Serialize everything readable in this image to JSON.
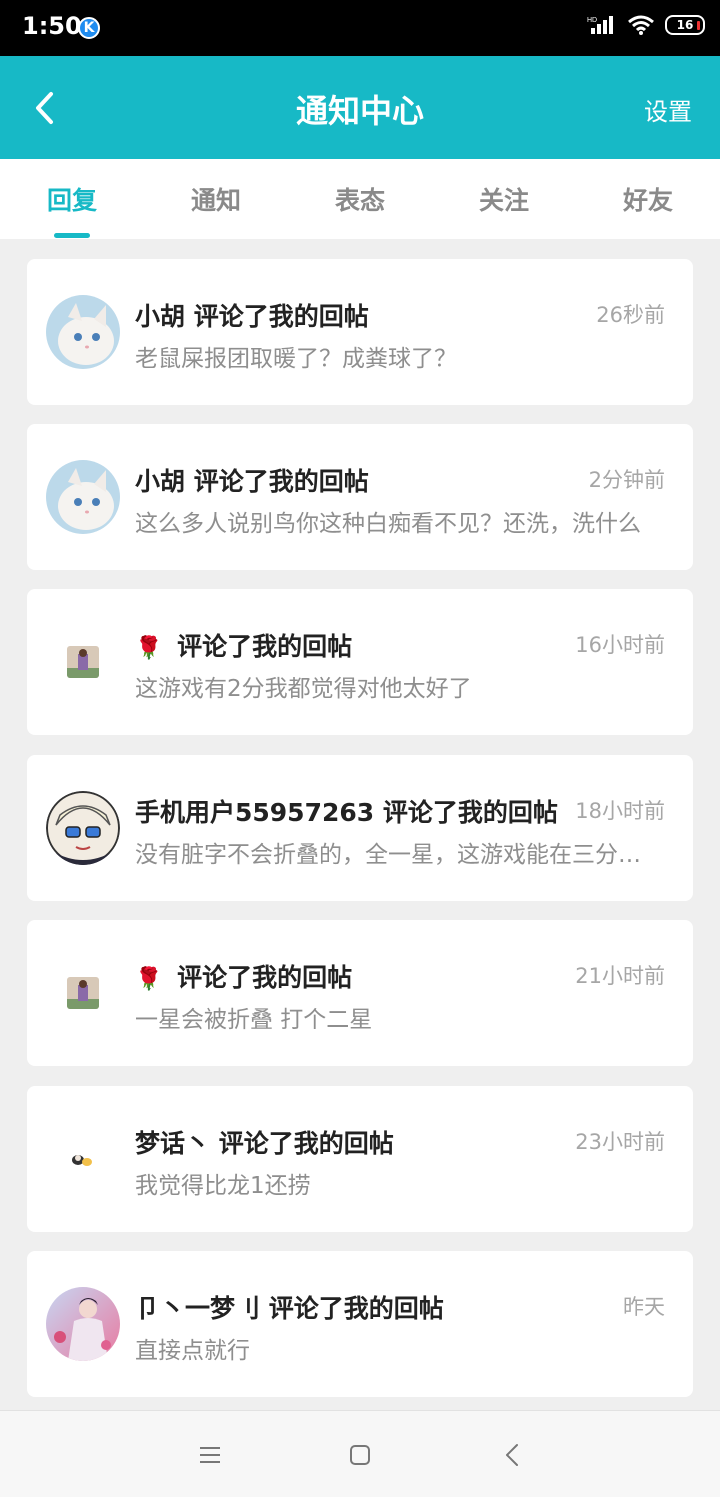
{
  "status_bar": {
    "time": "1:50",
    "app_icon": "K",
    "battery": "16"
  },
  "header": {
    "title": "通知中心",
    "settings": "设置"
  },
  "tabs": [
    {
      "label": "回复",
      "active": true
    },
    {
      "label": "通知",
      "active": false
    },
    {
      "label": "表态",
      "active": false
    },
    {
      "label": "关注",
      "active": false
    },
    {
      "label": "好友",
      "active": false
    }
  ],
  "notifications": [
    {
      "user": "小胡",
      "action": "评论了我的回帖",
      "time": "26秒前",
      "preview": "老鼠屎报团取暖了？成粪球了？"
    },
    {
      "user": "小胡",
      "action": "评论了我的回帖",
      "time": "2分钟前",
      "preview": "这么多人说别鸟你这种白痴看不见？还洗，洗什么"
    },
    {
      "user": "🌹",
      "action": "评论了我的回帖",
      "time": "16小时前",
      "preview": "这游戏有2分我都觉得对他太好了"
    },
    {
      "user": "手机用户55957263",
      "action": "评论了我的回帖",
      "time": "18小时前",
      "preview": "没有脏字不会折叠的，全一星，这游戏能在三分以上"
    },
    {
      "user": "🌹",
      "action": "评论了我的回帖",
      "time": "21小时前",
      "preview": "一星会被折叠  打个二星"
    },
    {
      "user": "梦话丶",
      "action": "评论了我的回帖",
      "time": "23小时前",
      "preview": "我觉得比龙1还捞"
    },
    {
      "user": "卩丶一梦刂",
      "action": "评论了我的回帖",
      "time": "昨天",
      "preview": "直接点就行"
    }
  ],
  "colors": {
    "accent": "#17b9c6",
    "background": "#efefef"
  }
}
